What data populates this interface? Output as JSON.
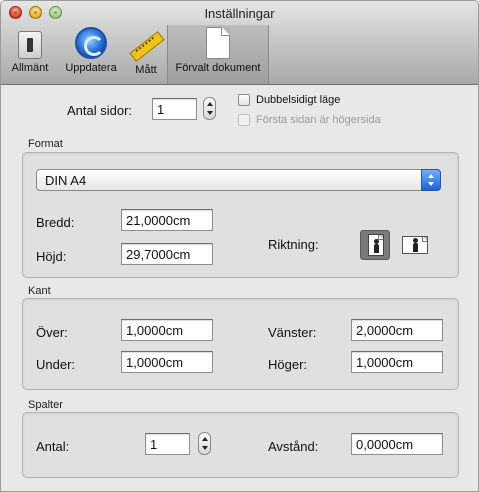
{
  "window": {
    "title": "Inställningar"
  },
  "toolbar": {
    "items": [
      {
        "label": "Allmänt",
        "icon": "switch-icon"
      },
      {
        "label": "Uppdatera",
        "icon": "update-icon"
      },
      {
        "label": "Mått",
        "icon": "ruler-icon"
      },
      {
        "label": "Förvalt dokument",
        "icon": "document-icon",
        "selected": true
      }
    ]
  },
  "pages": {
    "label": "Antal sidor:",
    "value": "1",
    "double_sided_label": "Dubbelsidigt läge",
    "first_page_right_label": "Första sidan är högersida"
  },
  "format": {
    "title": "Format",
    "paper_size": "DIN A4",
    "width_label": "Bredd:",
    "width_value": "21,0000cm",
    "height_label": "Höjd:",
    "height_value": "29,7000cm",
    "orientation_label": "Riktning:",
    "orientation_selected": "portrait"
  },
  "margins": {
    "title": "Kant",
    "top_label": "Över:",
    "top_value": "1,0000cm",
    "bottom_label": "Under:",
    "bottom_value": "1,0000cm",
    "left_label": "Vänster:",
    "left_value": "2,0000cm",
    "right_label": "Höger:",
    "right_value": "1,0000cm"
  },
  "columns": {
    "title": "Spalter",
    "count_label": "Antal:",
    "count_value": "1",
    "spacing_label": "Avstånd:",
    "spacing_value": "0,0000cm"
  }
}
